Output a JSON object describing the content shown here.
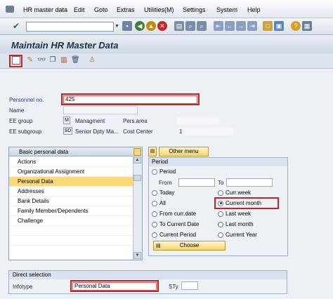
{
  "menu": {
    "items": [
      "HR master data",
      "Edit",
      "Goto",
      "Extras",
      "Utilities(M)",
      "Settings",
      "System",
      "Help"
    ]
  },
  "toolbar": {
    "command_value": ""
  },
  "title": "Maintain HR Master Data",
  "header": {
    "personnel_no_label": "Personnel no.",
    "personnel_no_value": "425",
    "name_label": "Name",
    "ee_group_label": "EE group",
    "ee_group_code": "M",
    "ee_group_text": "Managment",
    "pers_area_label": "Pers.area",
    "ee_subgroup_label": "EE subgroup",
    "ee_subgroup_code": "SD",
    "ee_subgroup_text": "Senior Dpty Ma...",
    "cost_center_label": "Cost Center",
    "cost_center_value": "1"
  },
  "infotype_list": {
    "header": "Basic personal data",
    "items": [
      "Actions",
      "Organizational Assignment",
      "Personal Data",
      "Addresses",
      "Bank Details",
      "Family Member/Dependents",
      "Challenge"
    ],
    "selected": "Personal Data"
  },
  "other_menu_label": "Other menu",
  "period": {
    "title": "Period",
    "period_label": "Period",
    "from_label": "From",
    "to_label": "To",
    "left_options": [
      "Today",
      "All",
      "From curr.date",
      "To Current Date",
      "Current Period"
    ],
    "right_options": [
      "Curr.week",
      "Current month",
      "Last week",
      "Last month",
      "Current Year"
    ],
    "selected": "Current month",
    "choose_label": "Choose"
  },
  "direct_selection": {
    "title": "Direct selection",
    "infotype_label": "Infotype",
    "infotype_value": "Personal Data",
    "sty_label": "STy",
    "sty_value": ""
  },
  "colors": {
    "highlight": "#d02020",
    "selected_row": "#fbd97a",
    "label_blue": "#1a3f99"
  }
}
